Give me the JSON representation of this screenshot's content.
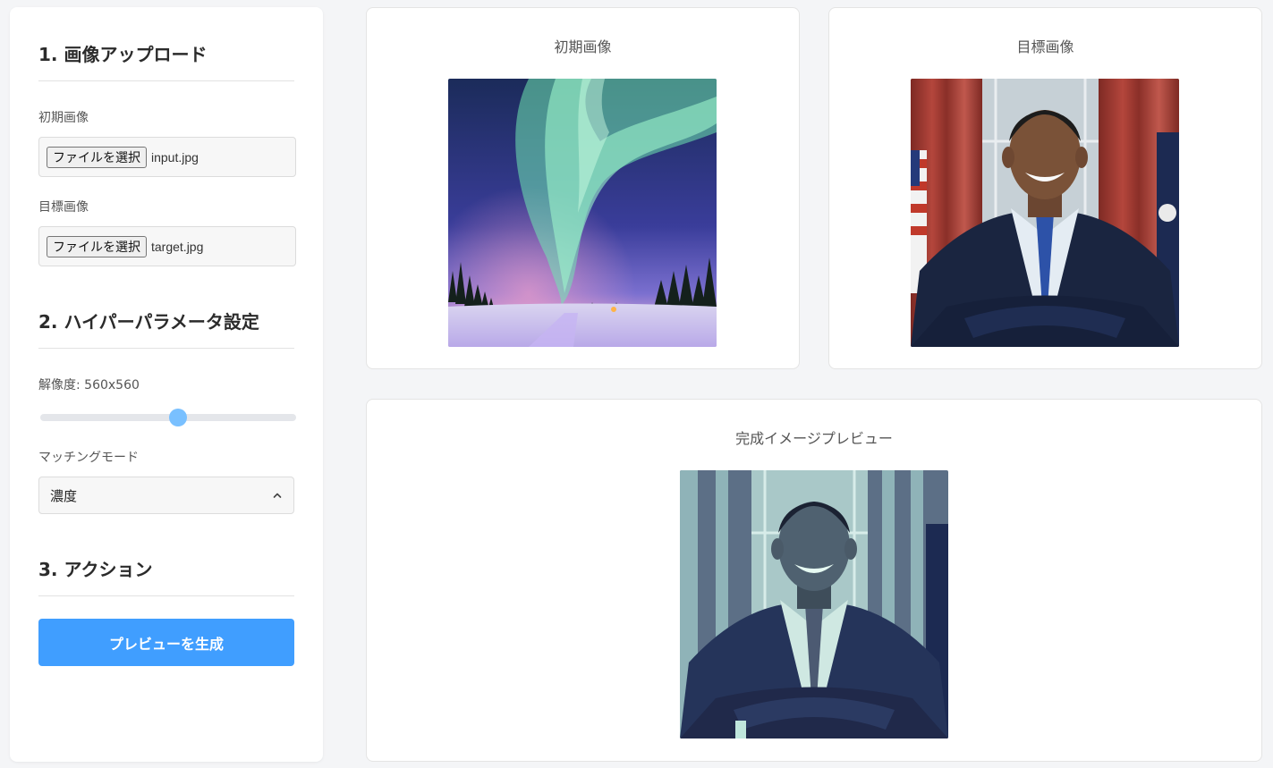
{
  "sidebar": {
    "section1_title": "1. 画像アップロード",
    "initial_label": "初期画像",
    "initial_button": "ファイルを選択",
    "initial_file": "input.jpg",
    "target_label": "目標画像",
    "target_button": "ファイルを選択",
    "target_file": "target.jpg",
    "section2_title": "2. ハイパーパラメータ設定",
    "resolution_label": "解像度: 560x560",
    "resolution_fraction": 0.54,
    "matching_label": "マッチングモード",
    "matching_value": "濃度",
    "section3_title": "3. アクション",
    "generate_button": "プレビューを生成"
  },
  "cards": {
    "initial_title": "初期画像",
    "target_title": "目標画像",
    "preview_title": "完成イメージプレビュー"
  },
  "colors": {
    "accent": "#409eff",
    "slider_thumb": "#79c0ff"
  }
}
